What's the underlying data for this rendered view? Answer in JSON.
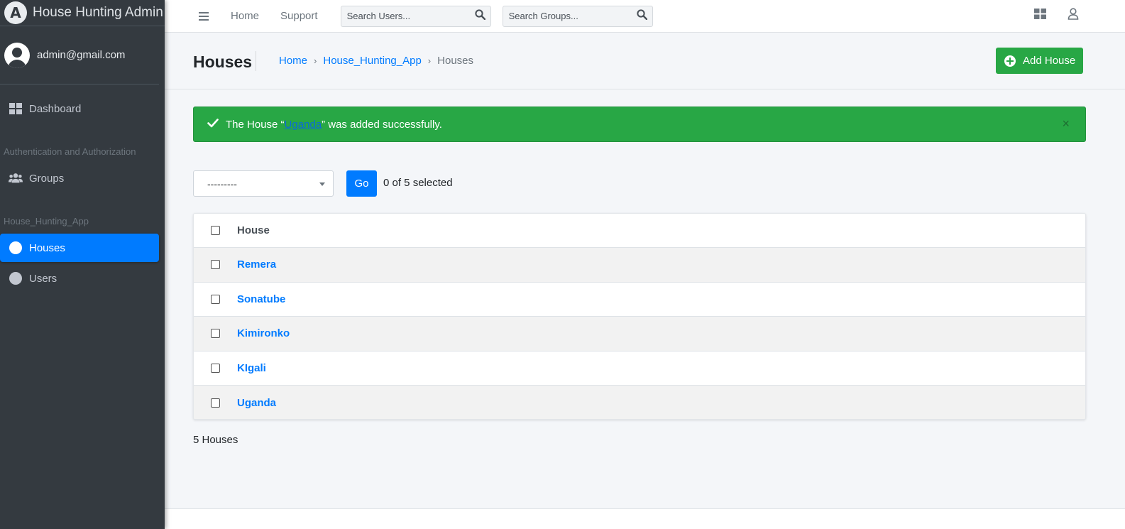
{
  "brand": {
    "title": "House Hunting Admin",
    "logo_letter": "A"
  },
  "user": {
    "email": "admin@gmail.com"
  },
  "sidebar": {
    "dashboard_label": "Dashboard",
    "section_auth": "Authentication and Authorization",
    "groups_label": "Groups",
    "section_app": "House_Hunting_App",
    "houses_label": "Houses",
    "users_label": "Users"
  },
  "topnav": {
    "home": "Home",
    "support": "Support",
    "search_users_placeholder": "Search Users...",
    "search_groups_placeholder": "Search Groups..."
  },
  "header": {
    "title": "Houses",
    "breadcrumb": [
      "Home",
      "House_Hunting_App",
      "Houses"
    ],
    "add_button": "Add House"
  },
  "alert": {
    "prefix": "The House “",
    "link": "Uganda",
    "suffix": "” was added successfully.",
    "close": "×"
  },
  "actions": {
    "select_value": "---------",
    "go_label": "Go",
    "selected_text": "0 of 5 selected"
  },
  "table": {
    "column": "House",
    "rows": [
      "Remera",
      "Sonatube",
      "Kimironko",
      "KIgali",
      "Uganda"
    ]
  },
  "footer": {
    "count_text": "5 Houses"
  },
  "colors": {
    "sidebar": "#343a40",
    "primary": "#007bff",
    "success": "#28a745"
  }
}
